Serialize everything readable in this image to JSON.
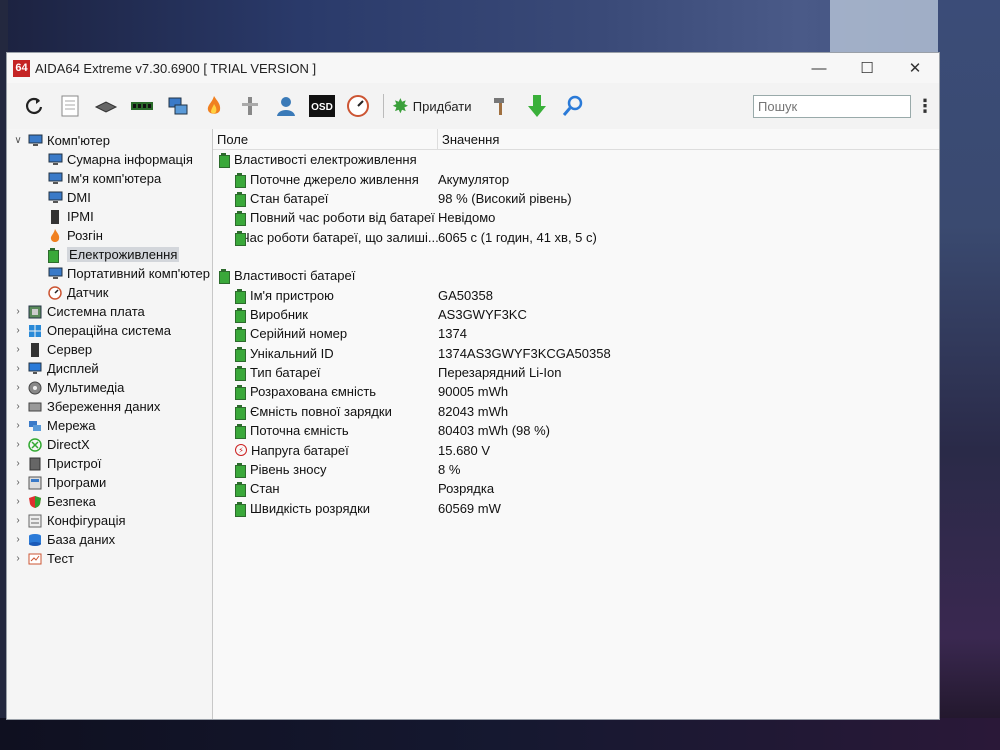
{
  "window": {
    "logo_text": "64",
    "title": "AIDA64 Extreme v7.30.6900  [ TRIAL VERSION ]",
    "minimize_glyph": "—",
    "maximize_glyph": "☐",
    "close_glyph": "✕"
  },
  "toolbar": {
    "buttons": [
      "refresh-icon",
      "report-icon",
      "motherboard-icon",
      "memory-icon",
      "network-icon",
      "flame-icon",
      "tools-icon",
      "user-icon",
      "osd-icon",
      "gauge-icon"
    ],
    "add_label": "Придбати",
    "osd_text": "OSD",
    "search_placeholder": "Пошук"
  },
  "tree": {
    "root": {
      "label": "Комп'ютер",
      "icon": "computer-icon"
    },
    "children": [
      {
        "label": "Сумарна інформація",
        "icon": "computer-icon"
      },
      {
        "label": "Ім'я комп'ютера",
        "icon": "computer-icon"
      },
      {
        "label": "DMI",
        "icon": "computer-icon"
      },
      {
        "label": "IPMI",
        "icon": "server-icon"
      },
      {
        "label": "Розгін",
        "icon": "flame-icon"
      },
      {
        "label": "Електроживлення",
        "icon": "battery-icon",
        "selected": true
      },
      {
        "label": "Портативний комп'ютер",
        "icon": "computer-icon"
      },
      {
        "label": "Датчик",
        "icon": "gauge-icon"
      }
    ],
    "sections": [
      {
        "label": "Системна плата",
        "icon": "motherboard-icon"
      },
      {
        "label": "Операційна система",
        "icon": "windows-icon"
      },
      {
        "label": "Сервер",
        "icon": "server-icon"
      },
      {
        "label": "Дисплей",
        "icon": "monitor-icon"
      },
      {
        "label": "Мультимедіа",
        "icon": "multimedia-icon"
      },
      {
        "label": "Збереження даних",
        "icon": "disk-icon"
      },
      {
        "label": "Мережа",
        "icon": "network-icon"
      },
      {
        "label": "DirectX",
        "icon": "directx-icon"
      },
      {
        "label": "Пристрої",
        "icon": "devices-icon"
      },
      {
        "label": "Програми",
        "icon": "programs-icon"
      },
      {
        "label": "Безпека",
        "icon": "shield-icon"
      },
      {
        "label": "Конфігурація",
        "icon": "config-icon"
      },
      {
        "label": "База даних",
        "icon": "database-icon"
      },
      {
        "label": "Тест",
        "icon": "test-icon"
      }
    ]
  },
  "list": {
    "col_field": "Поле",
    "col_value": "Значення",
    "groups": [
      {
        "title": "Властивості електроживлення",
        "items": [
          {
            "field": "Поточне джерело живлення",
            "value": "Акумулятор"
          },
          {
            "field": "Стан батареї",
            "value": "98 % (Високий рівень)"
          },
          {
            "field": "Повний час роботи від батареї",
            "value": "Невідомо"
          },
          {
            "field": "Час роботи батареї, що залиші...",
            "value": "6065 с (1 годин, 41 хв, 5 с)"
          }
        ]
      },
      {
        "title": "Властивості батареї",
        "items": [
          {
            "field": "Ім'я пристрою",
            "value": "GA50358"
          },
          {
            "field": "Виробник",
            "value": "AS3GWYF3KC"
          },
          {
            "field": "Серійний номер",
            "value": "1374"
          },
          {
            "field": "Унікальний ID",
            "value": "1374AS3GWYF3KCGA50358"
          },
          {
            "field": "Тип батареї",
            "value": "Перезарядний Li-Ion"
          },
          {
            "field": "Розрахована ємність",
            "value": "90005 mWh"
          },
          {
            "field": "Ємність повної зарядки",
            "value": "82043 mWh"
          },
          {
            "field": "Поточна ємність",
            "value": "80403 mWh  (98 %)"
          },
          {
            "field": "Напруга батареї",
            "value": "15.680 V",
            "icon": "voltage-icon"
          },
          {
            "field": "Рівень зносу",
            "value": "8 %"
          },
          {
            "field": "Стан",
            "value": "Розрядка"
          },
          {
            "field": "Швидкість розрядки",
            "value": "60569 mW"
          }
        ]
      }
    ]
  }
}
